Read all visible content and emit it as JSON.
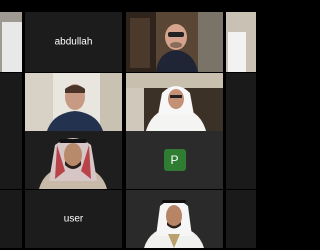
{
  "tiles": {
    "abdullah": {
      "name": "abdullah"
    },
    "user": {
      "name": "user"
    },
    "avatar_tile": {
      "initial": "P"
    }
  },
  "colors": {
    "background": "#000000",
    "tile_dark": "#1c1c1c",
    "avatar_green": "#2e7d32"
  }
}
